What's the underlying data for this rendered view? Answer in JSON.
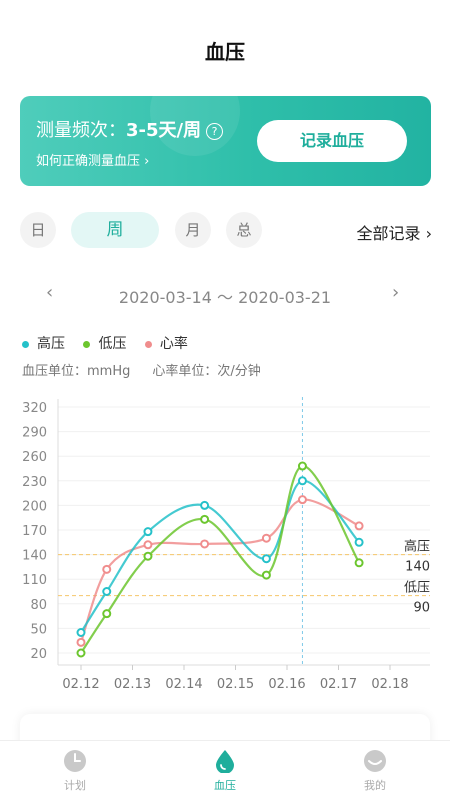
{
  "header": {
    "title": "血压"
  },
  "banner": {
    "freq_label": "测量频次：",
    "freq_value": "3-5天/周",
    "help_icon": "?",
    "how_link": "如何正确测量血压 ›",
    "record_button": "记录血压"
  },
  "filters": {
    "tabs": [
      "日",
      "周",
      "月",
      "总"
    ],
    "active_tab": "周",
    "all_records": "全部记录 ›"
  },
  "date_nav": {
    "prev": "‹",
    "range": "2020-03-14 ～ 2020-03-21",
    "next": "›"
  },
  "legend": {
    "items": [
      "高压",
      "低压",
      "心率"
    ],
    "bp_unit": "血压单位：mmHg",
    "hr_unit": "心率单位：次/分钟"
  },
  "chart_data": {
    "type": "line",
    "x": [
      "02.12",
      "02.13",
      "02.14",
      "02.15",
      "02.16",
      "02.17",
      "02.18"
    ],
    "y_ticks": [
      20,
      50,
      80,
      110,
      140,
      170,
      200,
      230,
      260,
      290,
      320
    ],
    "ylim": [
      20,
      320
    ],
    "series": [
      {
        "name": "高压",
        "color": "#25c1c9",
        "points": [
          [
            0.0,
            45
          ],
          [
            0.5,
            95
          ],
          [
            1.3,
            168
          ],
          [
            2.4,
            200
          ],
          [
            3.6,
            135
          ],
          [
            4.3,
            230
          ],
          [
            5.4,
            155
          ]
        ]
      },
      {
        "name": "低压",
        "color": "#6cc62e",
        "points": [
          [
            0.0,
            20
          ],
          [
            0.5,
            68
          ],
          [
            1.3,
            138
          ],
          [
            2.4,
            183
          ],
          [
            3.6,
            115
          ],
          [
            4.3,
            248
          ],
          [
            5.4,
            130
          ]
        ]
      },
      {
        "name": "心率",
        "color": "#f08d8d",
        "points": [
          [
            0.0,
            33
          ],
          [
            0.5,
            122
          ],
          [
            1.3,
            152
          ],
          [
            2.4,
            153
          ],
          [
            3.6,
            160
          ],
          [
            4.3,
            207
          ],
          [
            5.4,
            175
          ]
        ]
      }
    ],
    "reference_lines": [
      {
        "label": "高压",
        "value": 140,
        "value_label": "140"
      },
      {
        "label": "低压",
        "value": 90,
        "value_label": "90"
      }
    ],
    "highlight_x": 4.3,
    "grid": true
  },
  "tabbar": {
    "items": [
      {
        "label": "计划",
        "icon": "clock-icon"
      },
      {
        "label": "血压",
        "icon": "drop-icon"
      },
      {
        "label": "我的",
        "icon": "user-icon"
      }
    ],
    "active": "血压"
  },
  "colors": {
    "accent": "#1fae9c",
    "high": "#25c1c9",
    "low": "#6cc62e",
    "heart": "#f08d8d",
    "reference": "#f5c66a"
  }
}
